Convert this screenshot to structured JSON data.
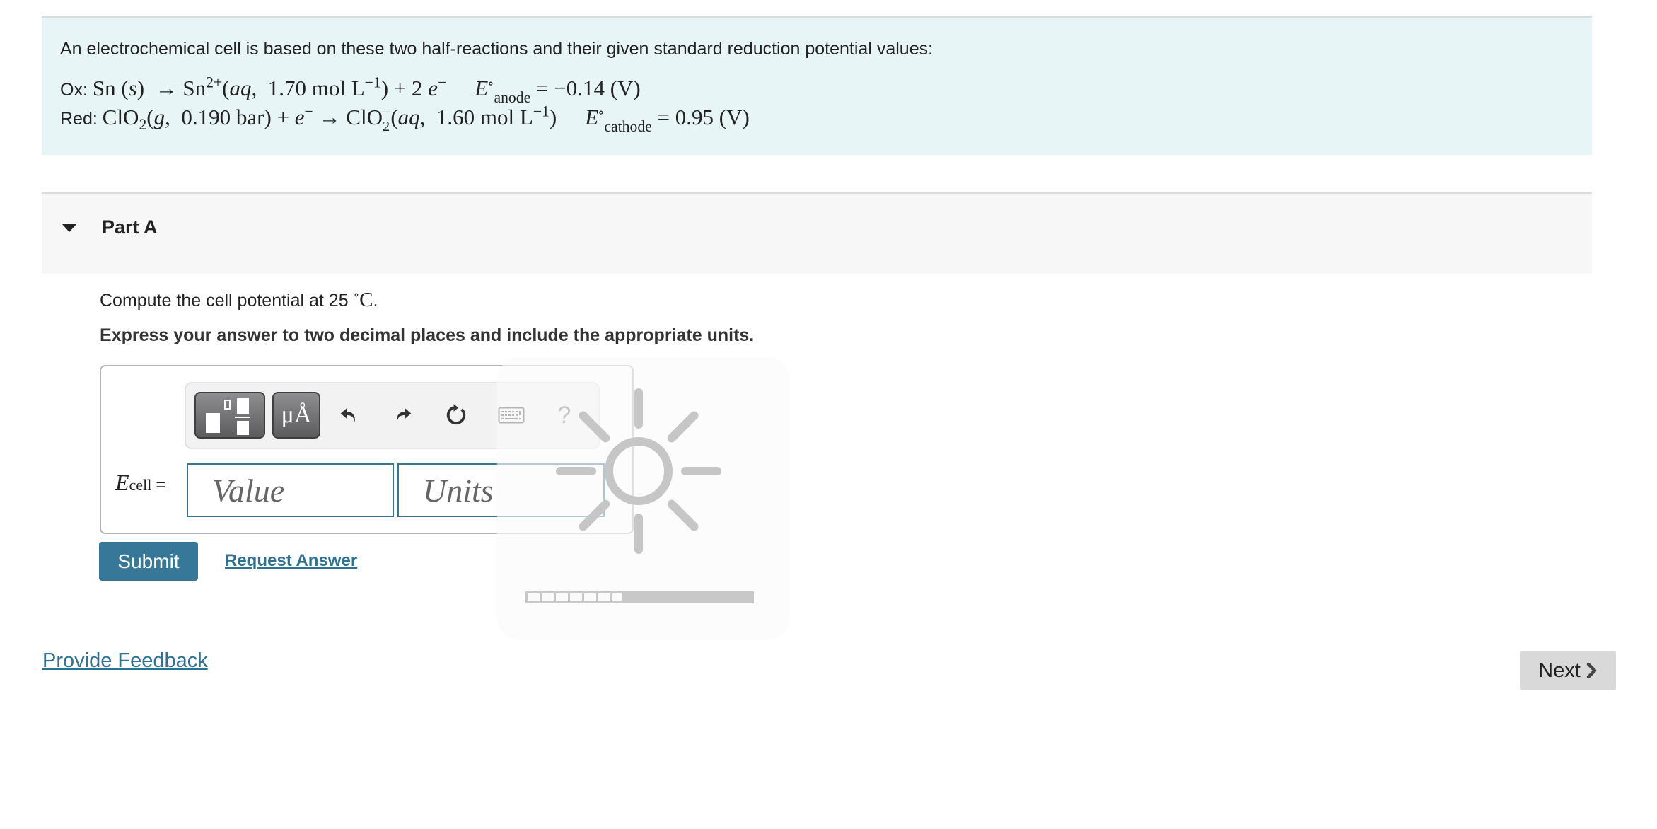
{
  "intro": {
    "text": "An electrochemical cell is based on these two half-reactions and their given standard reduction potential values:",
    "ox": {
      "label": "Ox: ",
      "reactant": "Sn",
      "reactant_state": "s",
      "arrow": "→",
      "product": "Sn",
      "product_charge": "2+",
      "product_state": "aq",
      "concentration": "1.70 mol L",
      "conc_exp": "−1",
      "electrons": "+ 2 ",
      "electron_symbol": "e",
      "electron_charge": "−",
      "potential_symbol": "E",
      "potential_degree": "∘",
      "potential_sub": "anode",
      "potential_value": "= −0.14 (V)"
    },
    "red": {
      "label": "Red: ",
      "reactant": "ClO",
      "reactant_sub": "2",
      "reactant_state": "g",
      "pressure": "0.190 bar",
      "electrons": " + ",
      "electron_symbol": "e",
      "electron_charge": "−",
      "arrow": "→",
      "product": "ClO",
      "product_sub": "2",
      "product_charge": "−",
      "product_state": "aq",
      "concentration": "1.60 mol L",
      "conc_exp": "−1",
      "potential_symbol": "E",
      "potential_degree": "∘",
      "potential_sub": "cathode",
      "potential_value": "= 0.95 (V)"
    }
  },
  "part": {
    "title": "Part A",
    "expanded": true,
    "question_prefix": "Compute the cell potential at 25 ",
    "question_unit": "°C",
    "question_suffix": ".",
    "instruction": "Express your answer to two decimal places and include the appropriate units."
  },
  "toolbar": {
    "templates_icon": "templates-icon",
    "units_label": "μÅ",
    "undo_icon": "undo-icon",
    "redo_icon": "redo-icon",
    "reset_icon": "reset-icon",
    "keyboard_icon": "keyboard-icon",
    "help_label": "?"
  },
  "answer": {
    "label_symbol": "E",
    "label_sub": "cell",
    "label_eq": "=",
    "value": "",
    "value_placeholder": "Value",
    "units": "",
    "units_placeholder": "Units"
  },
  "loading": {
    "icon": "sun-spinner-icon",
    "progress_percent": 43
  },
  "actions": {
    "submit": "Submit",
    "request_answer": "Request Answer",
    "provide_feedback": "Provide Feedback",
    "next": "Next"
  },
  "colors": {
    "accent": "#377899",
    "link": "#2f7190",
    "intro_bg": "#e8f5f6",
    "part_bg": "#f7f7f7"
  }
}
